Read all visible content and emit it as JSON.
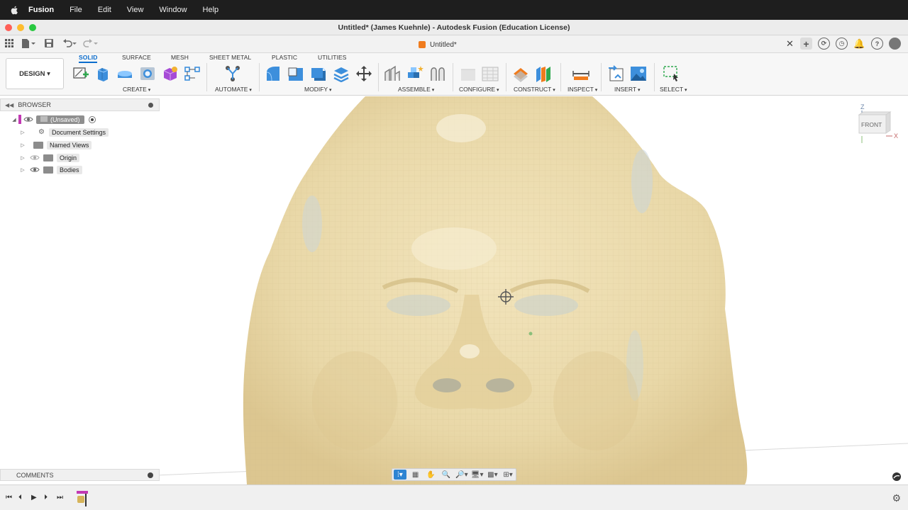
{
  "menubar": {
    "app_name": "Fusion",
    "items": [
      "File",
      "Edit",
      "View",
      "Window",
      "Help"
    ]
  },
  "window": {
    "title": "Untitled* (James Kuehnle) - Autodesk Fusion (Education License)"
  },
  "document_tab": {
    "name": "Untitled*"
  },
  "ribbon": {
    "workspace": "DESIGN",
    "tabs": [
      "SOLID",
      "SURFACE",
      "MESH",
      "SHEET METAL",
      "PLASTIC",
      "UTILITIES"
    ],
    "active_tab": "SOLID",
    "groups": [
      "CREATE",
      "AUTOMATE",
      "MODIFY",
      "ASSEMBLE",
      "CONFIGURE",
      "CONSTRUCT",
      "INSPECT",
      "INSERT",
      "SELECT"
    ]
  },
  "browser": {
    "title": "BROWSER",
    "root": "(Unsaved)",
    "items": [
      "Document Settings",
      "Named Views",
      "Origin",
      "Bodies"
    ]
  },
  "comments": {
    "title": "COMMENTS"
  },
  "viewcube": {
    "face": "FRONT",
    "axis_z": "Z",
    "axis_x": "X"
  },
  "colors": {
    "accent": "#0b6ccc",
    "model": "#ecdcae",
    "root_marker": "#c239b3",
    "doc_icon": "#f07c1e"
  }
}
